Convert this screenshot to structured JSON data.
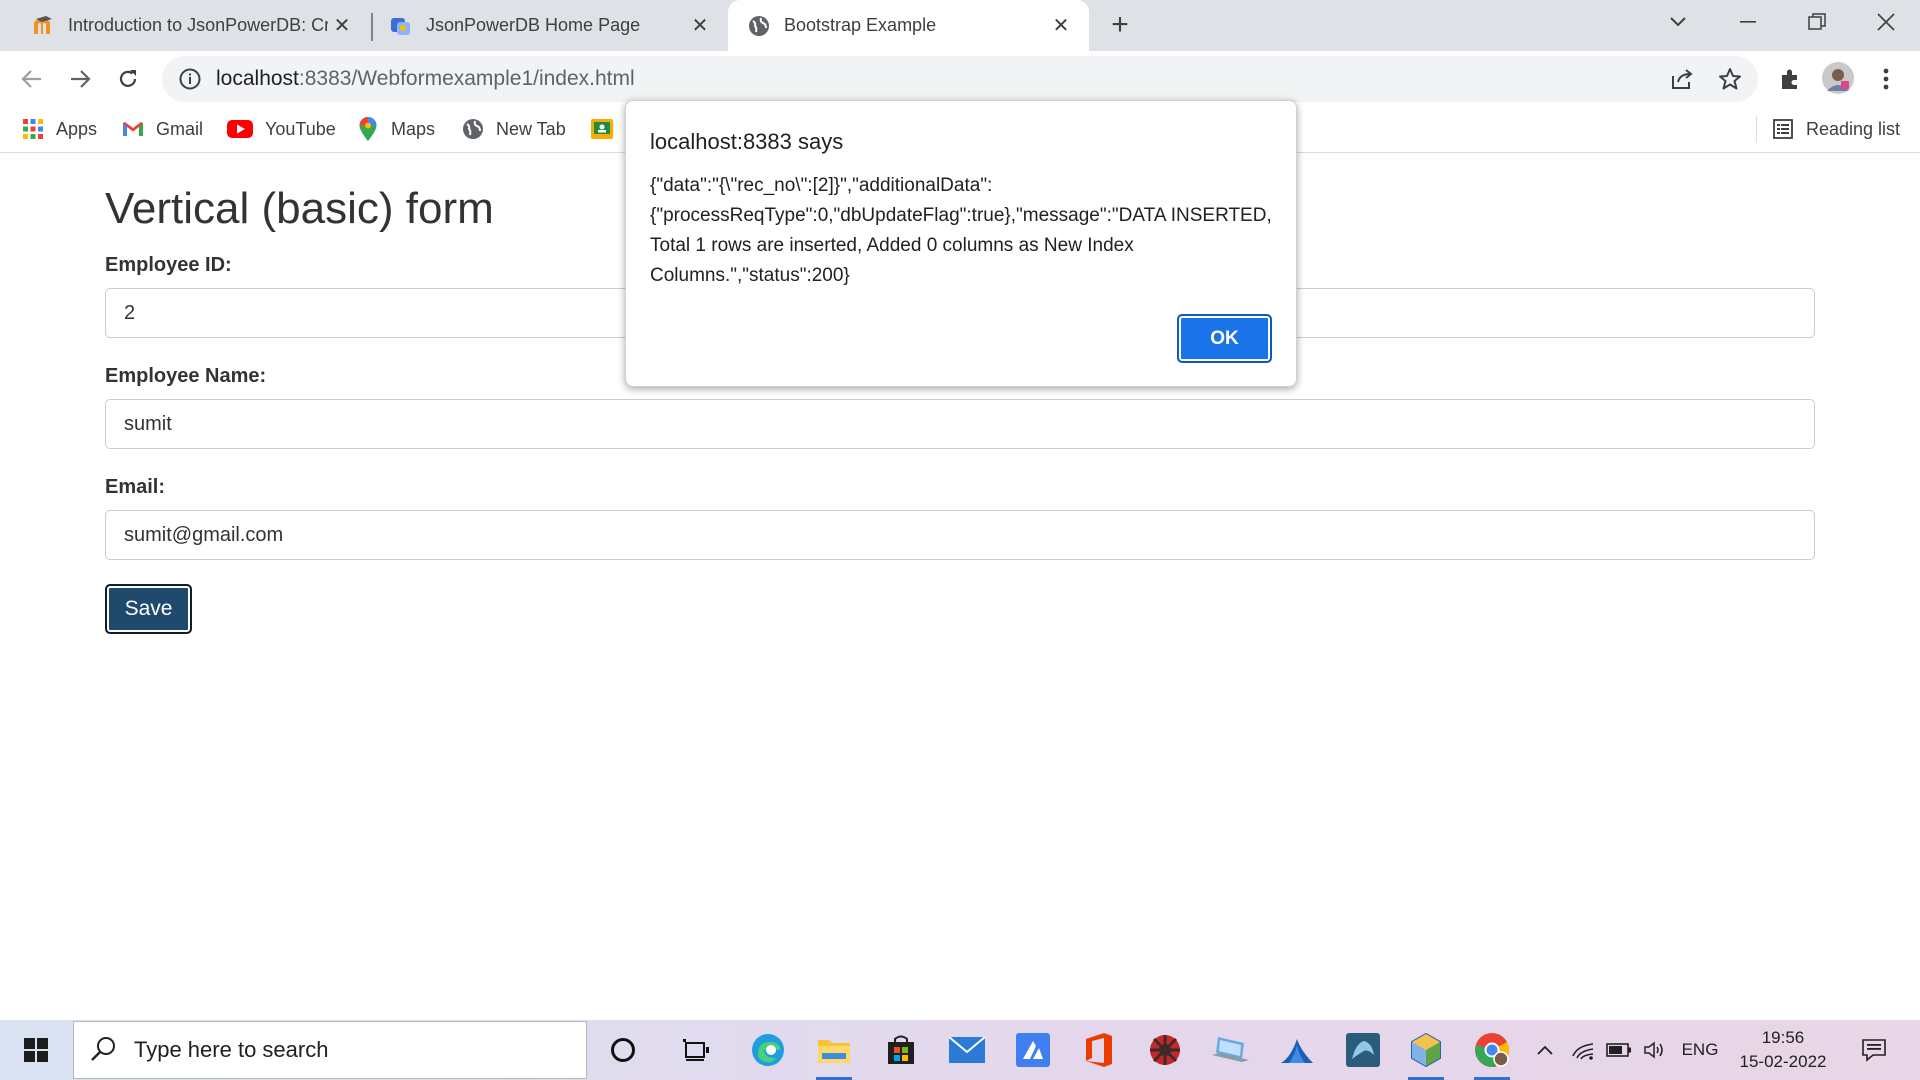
{
  "tabs": [
    {
      "title": "Introduction to JsonPowerDB: Cr",
      "favicon": "moodle-icon",
      "active": false
    },
    {
      "title": "JsonPowerDB Home Page",
      "favicon": "jpdb-icon",
      "active": false
    },
    {
      "title": "Bootstrap Example",
      "favicon": "globe-icon",
      "active": true
    }
  ],
  "toolbar": {
    "url_host": "localhost",
    "url_rest": ":8383/Webformexample1/index.html"
  },
  "bookmarks": [
    {
      "label": "Apps",
      "icon": "apps-grid-icon"
    },
    {
      "label": "Gmail",
      "icon": "gmail-icon"
    },
    {
      "label": "YouTube",
      "icon": "youtube-icon"
    },
    {
      "label": "Maps",
      "icon": "maps-icon"
    },
    {
      "label": "New Tab",
      "icon": "globe-icon"
    },
    {
      "label": "",
      "icon": "classroom-icon"
    }
  ],
  "reading_list": "Reading list",
  "form": {
    "heading": "Vertical (basic) form",
    "fields": [
      {
        "label": "Employee ID:",
        "value": "2"
      },
      {
        "label": "Employee Name:",
        "value": "sumit"
      },
      {
        "label": "Email:",
        "value": "sumit@gmail.com"
      }
    ],
    "save_label": "Save"
  },
  "dialog": {
    "title": "localhost:8383 says",
    "message": "{\"data\":\"{\\\"rec_no\\\":[2]}\",\"additionalData\":{\"processReqType\":0,\"dbUpdateFlag\":true},\"message\":\"DATA INSERTED, Total 1 rows are inserted, Added 0 columns as New Index Columns.\",\"status\":200}",
    "ok_label": "OK"
  },
  "taskbar": {
    "search_placeholder": "Type here to search",
    "language": "ENG",
    "time": "19:56",
    "date": "15-02-2022"
  },
  "colors": {
    "accent": "#1a73e8",
    "save_button": "#1f4a6e",
    "tabstrip": "#dee1e6"
  }
}
